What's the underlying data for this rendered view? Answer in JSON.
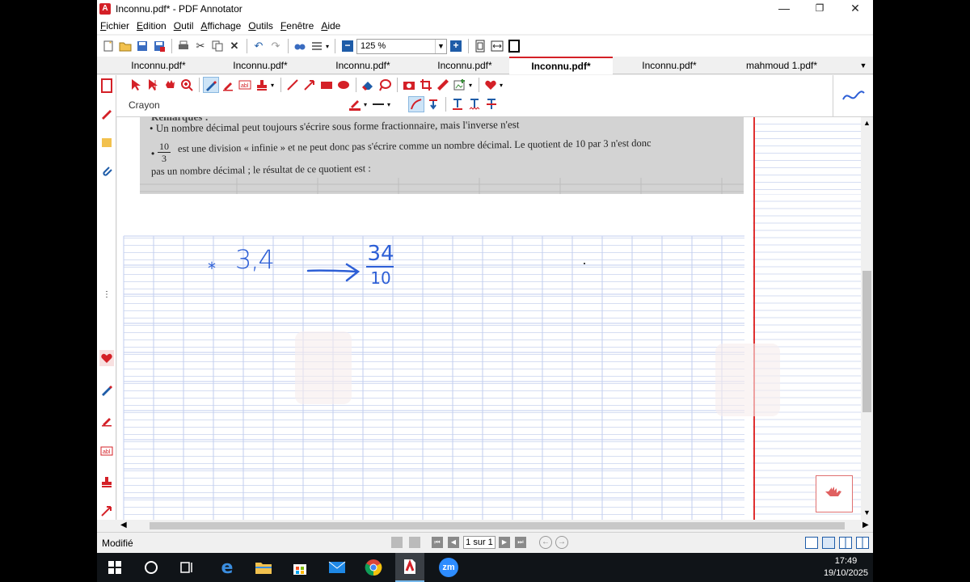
{
  "window": {
    "title": "Inconnu.pdf* - PDF Annotator",
    "minimize": "—",
    "maximize": "❐",
    "close": "✕"
  },
  "menu": [
    {
      "label": "Fichier",
      "key": "F"
    },
    {
      "label": "Edition",
      "key": "E"
    },
    {
      "label": "Outil",
      "key": "O"
    },
    {
      "label": "Affichage",
      "key": "A"
    },
    {
      "label": "Outils",
      "key": "O"
    },
    {
      "label": "Fenêtre",
      "key": "F"
    },
    {
      "label": "Aide",
      "key": "A"
    }
  ],
  "toolbar": {
    "zoom_value": "125 %",
    "zoom_minus": "−",
    "zoom_plus": "+"
  },
  "tabs": [
    {
      "label": "Inconnu.pdf*",
      "active": false
    },
    {
      "label": "Inconnu.pdf*",
      "active": false
    },
    {
      "label": "Inconnu.pdf*",
      "active": false
    },
    {
      "label": "Inconnu.pdf*",
      "active": false
    },
    {
      "label": "Inconnu.pdf*",
      "active": true
    },
    {
      "label": "Inconnu.pdf*",
      "active": false
    },
    {
      "label": "mahmoud 1.pdf*",
      "active": false
    }
  ],
  "annotation_toolbar": {
    "tool_name": "Crayon"
  },
  "document": {
    "scan_line1": "Remarques :",
    "scan_line2": "• Un nombre décimal peut toujours s'écrire sous forme fractionnaire, mais l'inverse n'est",
    "scan_frac_num": "10",
    "scan_frac_den": "3",
    "scan_line3": "est une division « infinie » et ne peut donc pas s'écrire comme un nombre décimal. Le quotient de 10 par 3 n'est donc",
    "scan_line4": "pas un nombre décimal ; le résultat de ce quotient est :",
    "handwriting": {
      "bullet": "*",
      "left": "3,4",
      "arrow": "⟶",
      "num": "34",
      "den": "10"
    }
  },
  "status": {
    "state": "Modifié",
    "page_label": "1 sur 1"
  },
  "taskbar": {
    "time": "17:49",
    "date": "19/10/2025",
    "zoom_app": "zm"
  },
  "colors": {
    "accent": "#d42027",
    "ink": "#2d5fd6",
    "grid": "#c9d4f0",
    "margin": "#e03030"
  }
}
